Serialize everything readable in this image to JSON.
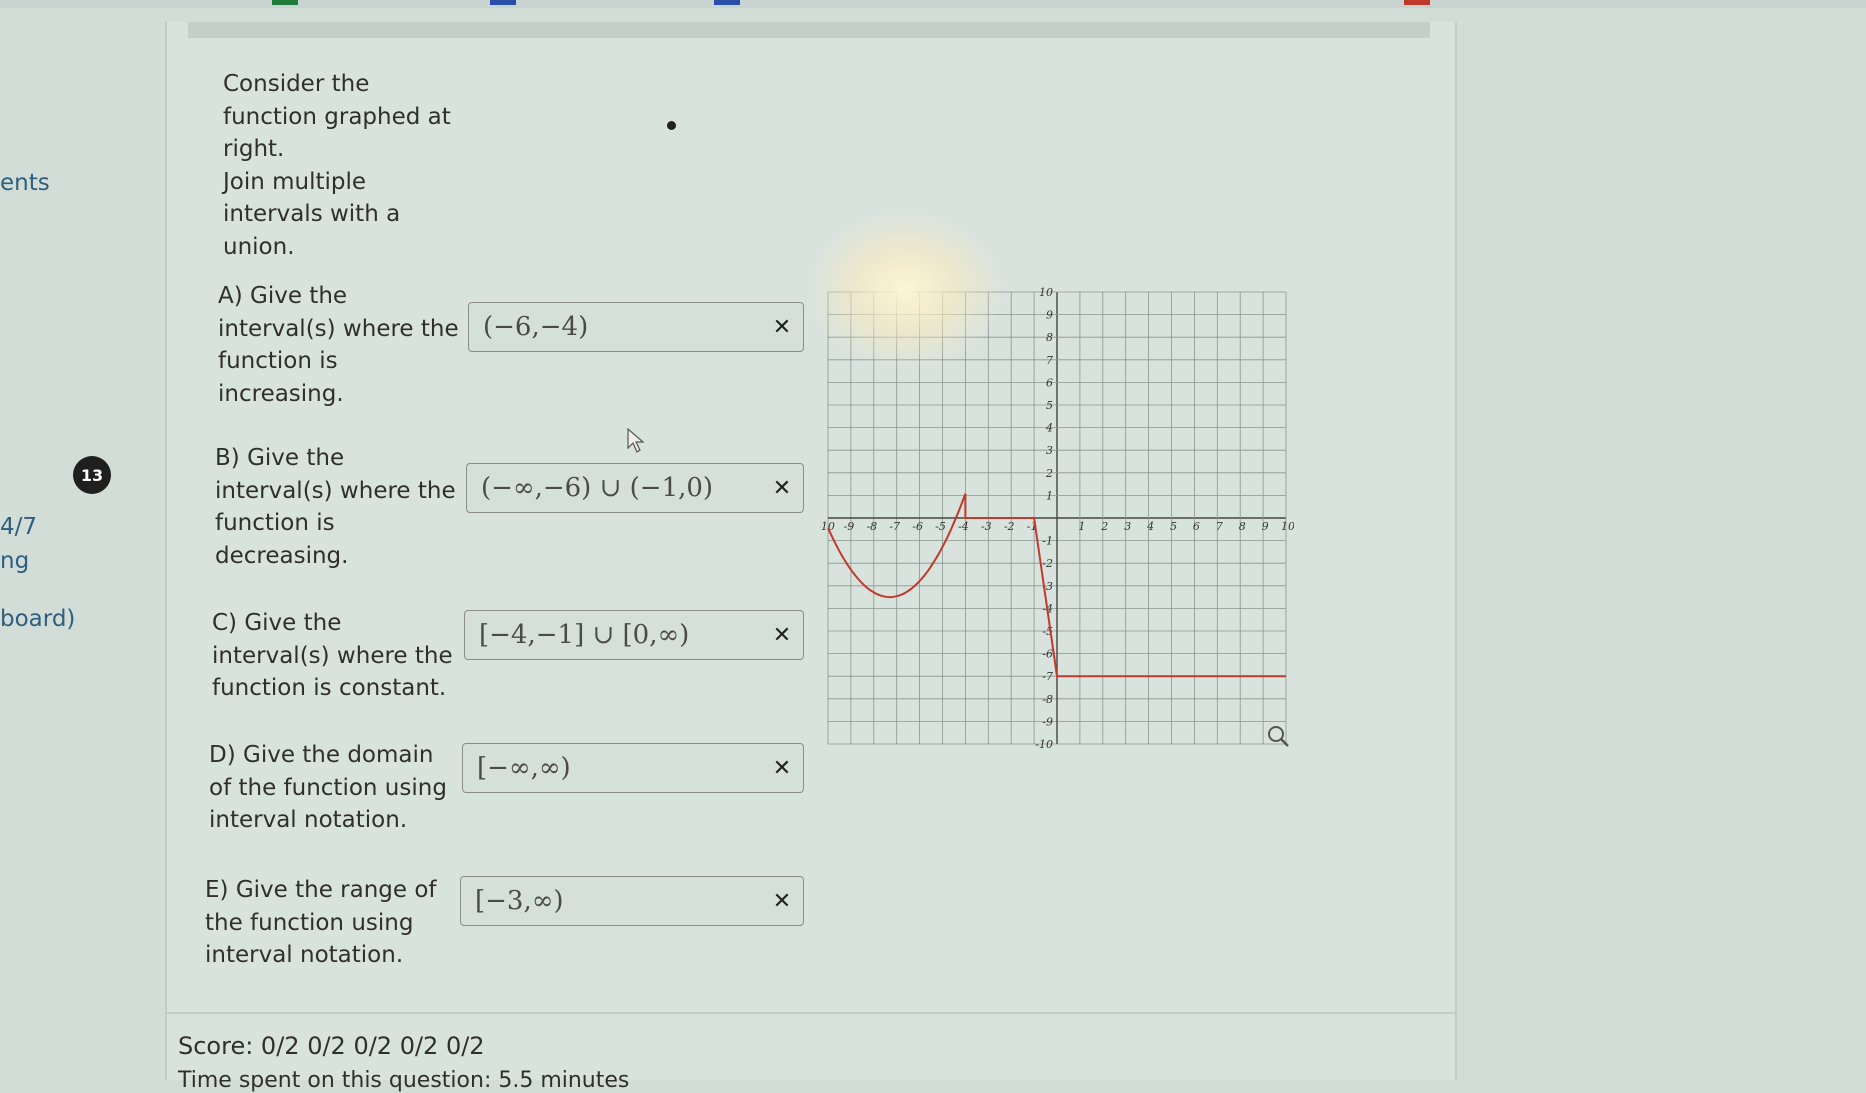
{
  "nav": {
    "items": [
      "ents",
      "4/7",
      "ng",
      "board)"
    ],
    "badge": "13"
  },
  "intro": {
    "line1": "Consider the",
    "line2": "function graphed at",
    "line3": "right.",
    "line4": "Join multiple",
    "line5": "intervals with a",
    "line6": "union."
  },
  "questions": [
    {
      "lines": [
        "A) Give the",
        "interval(s) where the",
        "function is",
        "increasing."
      ],
      "answer": "(−6,−4)"
    },
    {
      "lines": [
        "B) Give the",
        "interval(s) where the",
        "function is",
        "decreasing."
      ],
      "answer": "(−∞,−6) ∪ (−1,0)"
    },
    {
      "lines": [
        "C) Give the",
        "interval(s) where the",
        "function is constant."
      ],
      "answer": "[−4,−1] ∪ [0,∞)"
    },
    {
      "lines": [
        "D) Give the domain",
        "of the function using",
        "interval notation."
      ],
      "answer": "[−∞,∞)"
    },
    {
      "lines": [
        "E) Give the range of",
        "the function using",
        "interval notation."
      ],
      "answer": "[−3,∞)"
    }
  ],
  "answer_status_icon": "incorrect-x-icon",
  "graph": {
    "x_ticks": [
      "-10",
      "-9",
      "-8",
      "-7",
      "-6",
      "-5",
      "-4",
      "-3",
      "-2",
      "-1",
      "1",
      "2",
      "3",
      "4",
      "5",
      "6",
      "7",
      "8",
      "9",
      "10"
    ],
    "y_ticks": [
      "10",
      "9",
      "8",
      "7",
      "6",
      "5",
      "4",
      "3",
      "2",
      "1",
      "-1",
      "-2",
      "-3",
      "-4",
      "-5",
      "-6",
      "-7",
      "-8",
      "-9",
      "-10"
    ],
    "curve_color": "#c0392b",
    "zoom_icon": "magnifier-icon"
  },
  "score": {
    "text": "Score: 0/2 0/2 0/2 0/2 0/2",
    "next_line": "Time spent on this question: 5.5 minutes"
  }
}
